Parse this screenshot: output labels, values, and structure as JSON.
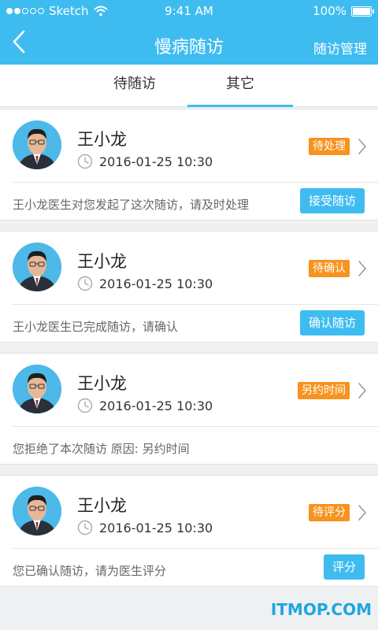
{
  "status_bar": {
    "carrier": "Sketch",
    "time": "9:41 AM",
    "battery": "100%",
    "battery_level": 1.0
  },
  "header": {
    "title": "慢病随访",
    "manage": "随访管理"
  },
  "tabs": [
    {
      "label": "待随访"
    },
    {
      "label": "其它",
      "active": true
    }
  ],
  "cards": [
    {
      "name": "王小龙",
      "time": "2016-01-25 10:30",
      "badge": "待处理",
      "note": "王小龙医生对您发起了这次随访，请及时处理",
      "action": "接受随访"
    },
    {
      "name": "王小龙",
      "time": "2016-01-25 10:30",
      "badge": "待确认",
      "note": "王小龙医生已完成随访，请确认",
      "action": "确认随访"
    },
    {
      "name": "王小龙",
      "time": "2016-01-25 10:30",
      "badge": "另约时间",
      "note": "您拒绝了本次随访   原因: 另约时间",
      "action": ""
    },
    {
      "name": "王小龙",
      "time": "2016-01-25 10:30",
      "badge": "待评分",
      "note": "您已确认随访，请为医生评分",
      "action": "评分"
    }
  ],
  "watermark": "ITMOP.COM",
  "colors": {
    "primary": "#3ebcf0",
    "badge": "#f7931e"
  }
}
